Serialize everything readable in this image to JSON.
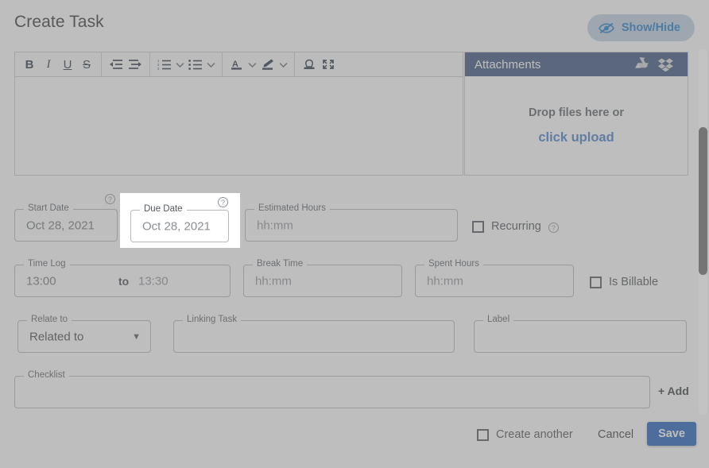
{
  "header": {
    "title": "Create Task",
    "show_hide_label": "Show/Hide",
    "show_hide_icon": "eye-slash-icon",
    "accent_blue": "#1673c4",
    "pill_bg": "#bcd0e0"
  },
  "editor": {
    "toolbar": [
      {
        "name": "bold",
        "glyph": "B"
      },
      {
        "name": "italic",
        "glyph": "I"
      },
      {
        "name": "underline",
        "glyph": "U"
      },
      {
        "name": "strikethrough",
        "glyph": "S"
      },
      {
        "name": "outdent",
        "glyph": "≡"
      },
      {
        "name": "indent",
        "glyph": "≡"
      },
      {
        "name": "ordered-list",
        "glyph": "1."
      },
      {
        "name": "ordered-list-options",
        "glyph": "⌄"
      },
      {
        "name": "unordered-list",
        "glyph": "•"
      },
      {
        "name": "unordered-list-options",
        "glyph": "⌄"
      },
      {
        "name": "font-color",
        "glyph": "A"
      },
      {
        "name": "font-color-options",
        "glyph": "⌄"
      },
      {
        "name": "highlight-color",
        "glyph": "✎"
      },
      {
        "name": "highlight-color-options",
        "glyph": "⌄"
      },
      {
        "name": "signature",
        "glyph": "Ω"
      },
      {
        "name": "fullscreen",
        "glyph": "⤡"
      }
    ],
    "content": ""
  },
  "attachments": {
    "title": "Attachments",
    "google_drive_icon": "google-drive-icon",
    "dropbox_icon": "dropbox-icon",
    "drop_text": "Drop files here or",
    "upload_link": "click upload",
    "header_bg": "#2e4a76",
    "link_color": "#3d77c2"
  },
  "form": {
    "start_date": {
      "legend": "Start Date",
      "value": "Oct 28, 2021",
      "help": "?"
    },
    "due_date": {
      "legend": "Due Date",
      "value": "Oct 28, 2021",
      "help": "?",
      "highlighted": true
    },
    "estimated_hours": {
      "legend": "Estimated Hours",
      "value": "hh:mm"
    },
    "recurring": {
      "label": "Recurring",
      "checked": false,
      "help": "?"
    },
    "time_log": {
      "legend": "Time Log",
      "start": "13:00",
      "separator": "to",
      "end": "13:30"
    },
    "break_time": {
      "legend": "Break Time",
      "value": "hh:mm"
    },
    "spent_hours": {
      "legend": "Spent Hours",
      "value": "hh:mm"
    },
    "is_billable": {
      "label": "Is Billable",
      "checked": false
    },
    "relate_to": {
      "legend": "Relate to",
      "value": "Related to",
      "caret": "▼"
    },
    "linking_task": {
      "legend": "Linking Task",
      "value": ""
    },
    "label_field": {
      "legend": "Label",
      "value": ""
    },
    "checklist": {
      "legend": "Checklist",
      "value": "",
      "add_label": "+ Add"
    }
  },
  "footer": {
    "create_another": {
      "label": "Create another",
      "checked": false
    },
    "cancel_label": "Cancel",
    "save_label": "Save",
    "save_bg": "#1456b8"
  },
  "scrollbar": {
    "name": "vertical-scrollbar"
  }
}
